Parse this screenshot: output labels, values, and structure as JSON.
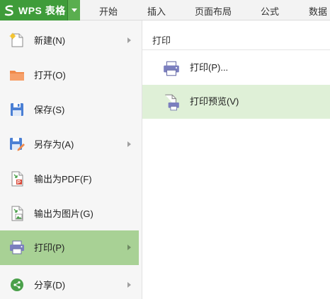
{
  "app": {
    "title": "WPS 表格",
    "logo_icon": "wps-s-logo",
    "brand_color": "#3f9c3a"
  },
  "ribbon": {
    "tabs": [
      {
        "label": "开始"
      },
      {
        "label": "插入"
      },
      {
        "label": "页面布局"
      },
      {
        "label": "公式"
      },
      {
        "label": "数据"
      }
    ]
  },
  "file_menu": {
    "items": [
      {
        "label": "新建(N)",
        "icon": "new-file-icon",
        "has_submenu": true
      },
      {
        "label": "打开(O)",
        "icon": "folder-icon",
        "has_submenu": false
      },
      {
        "label": "保存(S)",
        "icon": "save-icon",
        "has_submenu": false
      },
      {
        "label": "另存为(A)",
        "icon": "save-as-icon",
        "has_submenu": true
      },
      {
        "label": "输出为PDF(F)",
        "icon": "pdf-icon",
        "has_submenu": false
      },
      {
        "label": "输出为图片(G)",
        "icon": "image-icon",
        "has_submenu": false
      },
      {
        "label": "打印(P)",
        "icon": "printer-icon",
        "has_submenu": true,
        "active": true
      },
      {
        "label": "分享(D)",
        "icon": "share-icon",
        "has_submenu": true
      }
    ],
    "active_color": "#a8d195"
  },
  "submenu": {
    "title": "打印",
    "items": [
      {
        "label": "打印(P)...",
        "icon": "printer-icon"
      },
      {
        "label": "打印预览(V)",
        "icon": "print-preview-icon",
        "hovered": true
      }
    ],
    "hover_color": "#dff0d7"
  }
}
